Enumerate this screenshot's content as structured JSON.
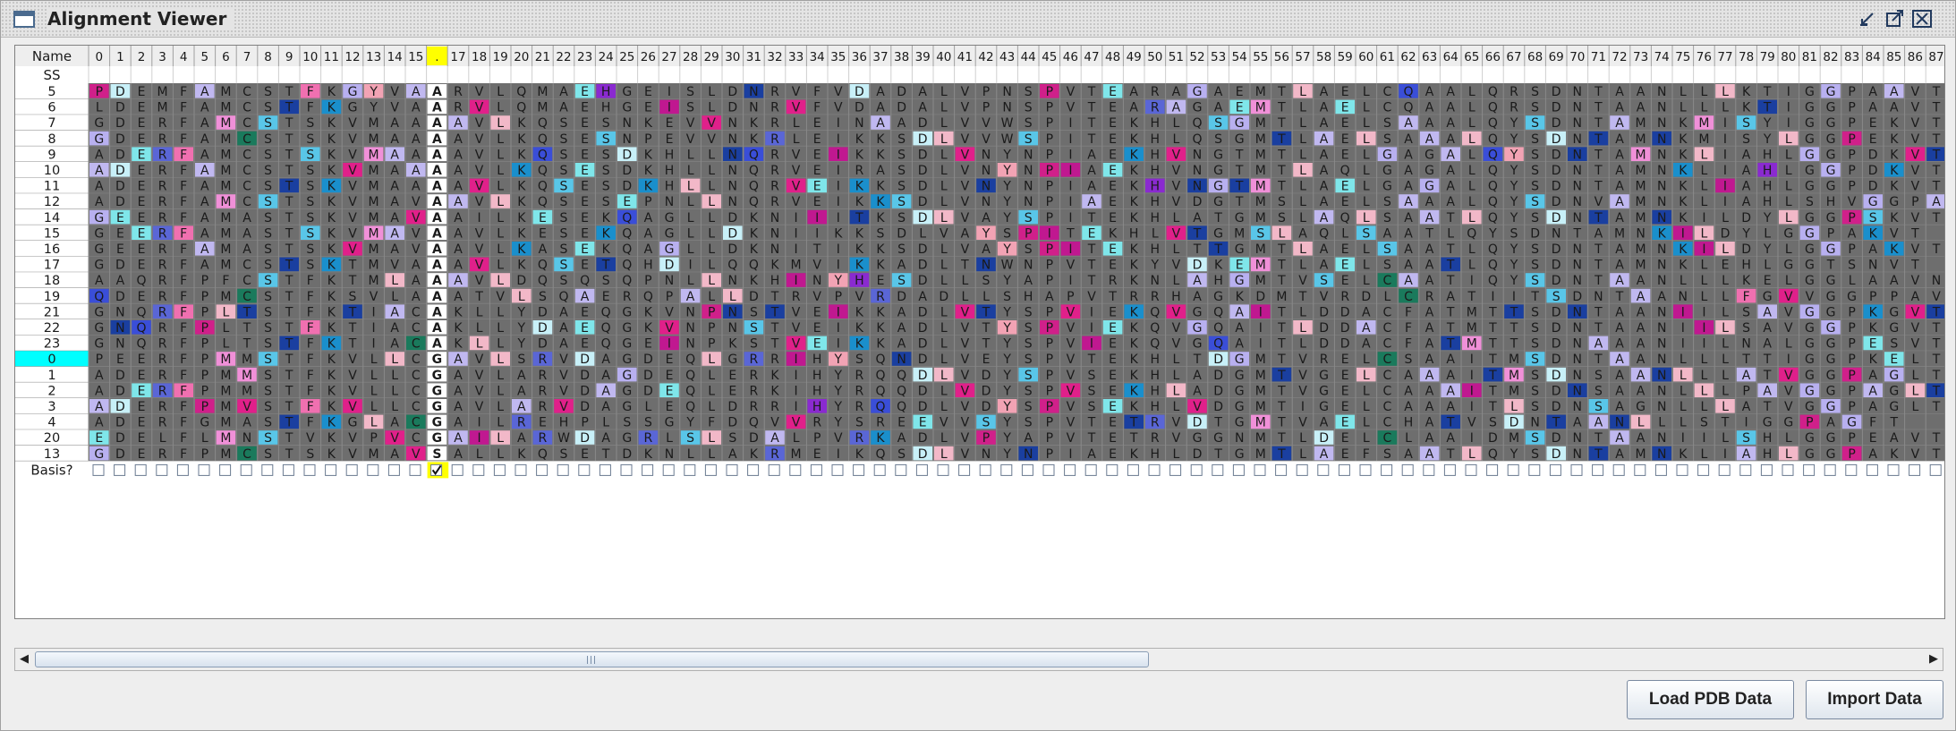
{
  "window": {
    "title": "Alignment Viewer",
    "minimize_icon": "minimize-icon",
    "maximize_icon": "maximize-icon",
    "close_icon": "close-icon"
  },
  "table": {
    "corner_header": "Name",
    "ss_label": "SS",
    "basis_label": "Basis?",
    "selected_column": "16",
    "selected_column_label": ".",
    "checked_basis_column": "16",
    "columns": [
      "0",
      "1",
      "2",
      "3",
      "4",
      "5",
      "6",
      "7",
      "8",
      "9",
      "10",
      "11",
      "12",
      "13",
      "14",
      "15",
      ".",
      "17",
      "18",
      "19",
      "20",
      "21",
      "22",
      "23",
      "24",
      "25",
      "26",
      "27",
      "28",
      "29",
      "30",
      "31",
      "32",
      "33",
      "34",
      "35",
      "36",
      "37",
      "38",
      "39",
      "40",
      "41",
      "42",
      "43",
      "44",
      "45",
      "46",
      "47",
      "48",
      "49",
      "50",
      "51",
      "52",
      "53",
      "54",
      "55",
      "56",
      "57",
      "58",
      "59",
      "60",
      "61",
      "62",
      "63",
      "64",
      "65",
      "66",
      "67",
      "68",
      "69",
      "70",
      "71",
      "72",
      "73",
      "74",
      "75",
      "76",
      "77",
      "78",
      "79",
      "80",
      "81",
      "82",
      "83",
      "84",
      "85",
      "86",
      "87"
    ],
    "rows": [
      {
        "name": "5",
        "seq": "PDEMFAMCSTFKGYVAARVLQMAEHGEISLDNRVFVDADALVPNSPVTEARAGAEMTLAELCQAALQRSDNTAANLLLKTIGGPAAVT"
      },
      {
        "name": "6",
        "seq": "LDEMFAMCSTFKGYVAARVLQMAEHGEISLDNRVFVDADALVPNSPVTEARAGAEMTLAELCQAALQRSDNTAANLLLKTIGGPAAVT"
      },
      {
        "name": "7",
        "seq": "GDERFAMCSTSKVMAAAAVLKQSESNKEVVNKRLEINAADLVVWSPITEKHLQSGMTLAELSAAALQYSDNTAMNKMISYIGGPEKVT"
      },
      {
        "name": "8",
        "seq": "GDERFAMCSTSKVMAAAAVLKQSESNPEVVNKRLEIKKSDLVVWSPITEKHLQSGMTLAELSAAALQYSDNTAMNKMISYLGGPEKVT"
      },
      {
        "name": "9",
        "seq": "ADERFAMCSTSKVMAAAAVLKQSESDKHLLNQRVEIKKSDLVNYNPIAEKHVNGTMTLAELGAGALQYSDNTAMNKLIAHLGGPDKVT"
      },
      {
        "name": "10",
        "seq": "ADERFAMCSTSKVMAAAAVLKQSESDKHLLNQRVEIRASDLVNYNPIAEKHVNGTMTLAQLGAGALQYSDNTAMNKLIAHLGGPDKVT"
      },
      {
        "name": "11",
        "seq": "ADERFAMCSTSKVMAAAAVLKQSESDKHLLNQRVEIKKSDLVNYNPIAEKHVNGTMTLAELGAGALQYSDNTAMNKLIAHLGGPDKVT"
      },
      {
        "name": "12",
        "seq": "ADERFAMCSTSKVMAVAAVLKQSESEPNLLNQRVEIKKSDLVNYNPIAEKHVDGTMSLAELSAAALQYSDNVAMNKLIAHLSHVGGPASVT"
      },
      {
        "name": "14",
        "seq": "GEERFAMASTSKVMAVAAILKESEKQAGLLDKNIIITKSDLVAYSPITEKHLATGMSLAQLSAATLQYSDNTAMNKILDYLGGPSKVT"
      },
      {
        "name": "15",
        "seq": "GEERFAMASTSKVMAVAAVLKESEKQAGLLDKNIIKKSDLVAYSPITEKHLVTGMSLAQLSAATLQYSDNTAMNKILDYLGGPAKVT"
      },
      {
        "name": "16",
        "seq": "GEERFAMASTSKVMAVAAVLKASEKQAGLLDKNITIKKSDLVAYSPITEKHLTTGMTLAELSAATLQYSDNTAMNKILDYLGGPAKVT"
      },
      {
        "name": "17",
        "seq": "GDERFAMCSTSKTMVAAAVLKQSETQHDILQQKMVIKKADLTNWNPVTEKYVDKEMTLAELSAATLQYSDNTAMNKLEHLGGTSNVT"
      },
      {
        "name": "18",
        "seq": "AAQRFPFCSTFKTMLAAAVLDQSQSQPNLLNKHINYHESDLLSYAPITRKNLAHGMTVSELCAATIQYSDNTAANLLLKELGGLAAVN"
      },
      {
        "name": "19",
        "seq": "QDERFPMCSTFKSVLAAATVLSQAERQPALLDTRVPVRDADLLSHAPVTRRHAGKDMTVRDLCRATIITSDNTAANLLFGVVGGPPAVT"
      },
      {
        "name": "21",
        "seq": "GNQRFPLTSTFKTIACAKLLYDAEQGKVNPNSTVEIKKADLVTYSPVIEKQVGQAITLDDACFATMTTSDNTAANIILSAVGGPKGVT"
      },
      {
        "name": "22",
        "seq": "GNQRFPLTSTFKTIACAKLLYDAEQGKVNPNSTVEIKKADLVTYSPVIEKQVGQAITLDDACFATMTTSDNTAANIILSAVGGPKGVT"
      },
      {
        "name": "23",
        "seq": "GNQRFPLTSTFKTIACAKLLYDAEQGEINPKSTVEIKKADLVTYSPVIEKQVGQAITLDDACFATMTTSDNAAANIILNALGGPESVT"
      },
      {
        "name": "0",
        "seq": "PEERFPMMSTFKVLLCGAVLSRVDAGDEQLGRRIHYSQNDLVEYSPVTEKHLTDGMTVRELCSAAITMSDNTAANLLLTTIGGPKELT"
      },
      {
        "name": "1",
        "seq": "ADERFPMMSTFKVLLCGAVLARVDAGDEQLERKIHYRQQDLVDYSPVSEKHLADGMTVGELCAAAITMSDNSAANLLLATVGGPAGLT"
      },
      {
        "name": "2",
        "seq": "ADERFPMMSTFKVLLCGAVLARVDAGDEQLERKIHYRQQDLVDYSPVSEKHLADGMTVGELCAAAITMSDNSAANLLLPAVGGPAGLT"
      },
      {
        "name": "3",
        "seq": "ADERFPMVSTFKVLLCGAVLARVDAGLEQLDRRIHYRQQDLVDYSPVSEKHLVDGMTIGELCAAAITLSDNSAGNLLLATVGGPAGLT"
      },
      {
        "name": "4",
        "seq": "ADERFGMASTFKGLACGAILREHPLSSGYFDQVVRYSREEVVSYSPVTETRVDTGMTVAELCHATVSDNTAANLLLSTIGGPAGFT"
      },
      {
        "name": "20",
        "seq": "EDELFLMNSTVKVPVCGAILARWDAGRLSLSDALPVRKADLVPYAPVTETRVGGNMTLDELCLAAIDMSDNTAANIILSHLGGPEAVT"
      },
      {
        "name": "13",
        "seq": "GDERFPMCSTSKVMAVSALLKQSETDKNLLAKRMEIKQSDLVNYNPIAEKHLDTGMTLAEFSAATLQYSDNTAMNKLIAHLGGPAKVT"
      }
    ]
  },
  "colors": {
    "grid_bg": "#6e6e6e",
    "grid_line": "#8a8a8a",
    "header_bg": "#eeeeee",
    "row_name_bg": "#ffffff",
    "selected_column_bg": "#ffff00",
    "selected_row_bg": "#00ffff",
    "selected_column_cell_bg": "#ffffff",
    "text": "#1a1a1a"
  },
  "buttons": {
    "load_pdb": "Load PDB Data",
    "import": "Import Data"
  }
}
